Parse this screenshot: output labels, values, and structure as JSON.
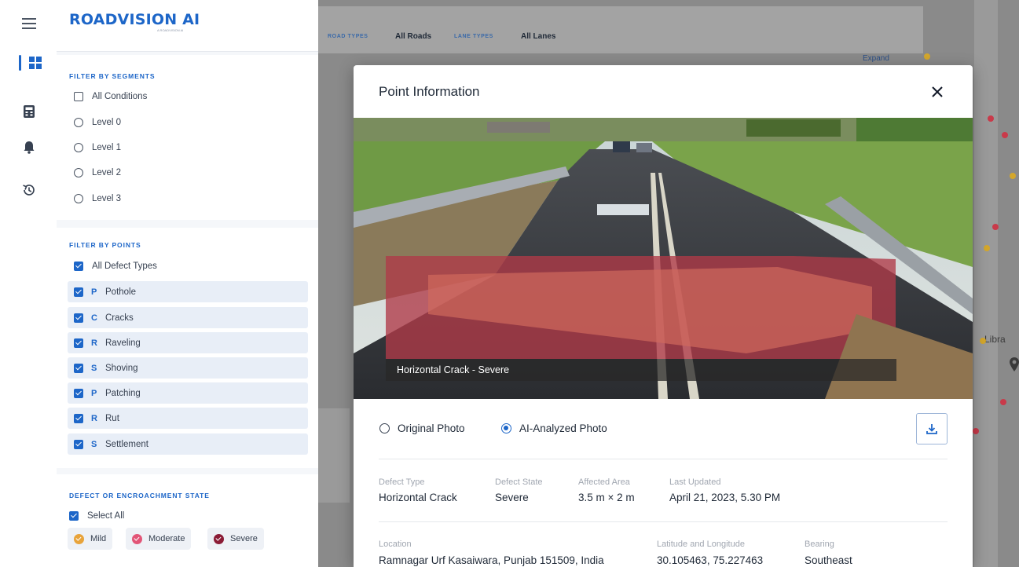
{
  "app": {
    "logo": "ROADVISION AI",
    "logo_sub": "A ROADVISION AI"
  },
  "rail": {
    "icons": [
      "menu-icon",
      "dashboard-icon",
      "calculator-icon",
      "bell-icon",
      "history-icon"
    ]
  },
  "sidebar": {
    "segments": {
      "title": "FILTER BY SEGMENTS",
      "all_label": "All Conditions",
      "levels": [
        "Level 0",
        "Level 1",
        "Level 2",
        "Level 3"
      ]
    },
    "points": {
      "title": "FILTER BY POINTS",
      "all_label": "All Defect Types",
      "defects": [
        {
          "code": "P",
          "label": "Pothole"
        },
        {
          "code": "C",
          "label": "Cracks"
        },
        {
          "code": "R",
          "label": "Raveling"
        },
        {
          "code": "S",
          "label": "Shoving"
        },
        {
          "code": "P",
          "label": "Patching"
        },
        {
          "code": "R",
          "label": "Rut"
        },
        {
          "code": "S",
          "label": "Settlement"
        }
      ]
    },
    "state": {
      "title": "DEFECT OR ENCROACHMENT STATE",
      "select_all": "Select All",
      "mild": "Mild",
      "moderate": "Moderate",
      "severe": "Severe"
    }
  },
  "map": {
    "road_types_label": "ROAD TYPES",
    "road_types_value": "All Roads",
    "lane_types_label": "LANE TYPES",
    "lane_types_value": "All Lanes",
    "expand": "Expand",
    "labels": [
      "Libra"
    ]
  },
  "modal": {
    "title": "Point Information",
    "caption": "Horizontal Crack - Severe",
    "original_photo": "Original Photo",
    "ai_photo": "AI-Analyzed Photo",
    "fields": {
      "defect_type_label": "Defect Type",
      "defect_type": "Horizontal Crack",
      "defect_state_label": "Defect State",
      "defect_state": "Severe",
      "affected_area_label": "Affected Area",
      "affected_area": "3.5 m × 2 m",
      "last_updated_label": "Last Updated",
      "last_updated": "April 21, 2023, 5.30 PM",
      "location_label": "Location",
      "location": "Ramnagar Urf Kasaiwara, Punjab 151509, India",
      "latlng_label": "Latitude and Longitude",
      "latlng": "30.105463, 75.227463",
      "bearing_label": "Bearing",
      "bearing": "Southeast"
    }
  },
  "colors": {
    "accent": "#1d66c8",
    "mild": "#e8a33a",
    "moderate": "#e25577",
    "severe": "#8b1c36"
  }
}
